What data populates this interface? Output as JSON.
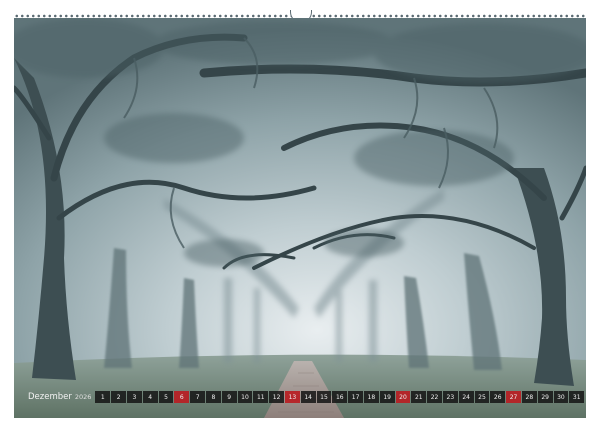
{
  "calendar": {
    "month": "Dezember",
    "year": "2026",
    "days": [
      "1",
      "2",
      "3",
      "4",
      "5",
      "6",
      "7",
      "8",
      "9",
      "10",
      "11",
      "12",
      "13",
      "14",
      "15",
      "16",
      "17",
      "18",
      "19",
      "20",
      "21",
      "22",
      "23",
      "24",
      "25",
      "26",
      "27",
      "28",
      "29",
      "30",
      "31"
    ],
    "sunday_color": "#b91e23",
    "weekday_color": "#141414"
  }
}
